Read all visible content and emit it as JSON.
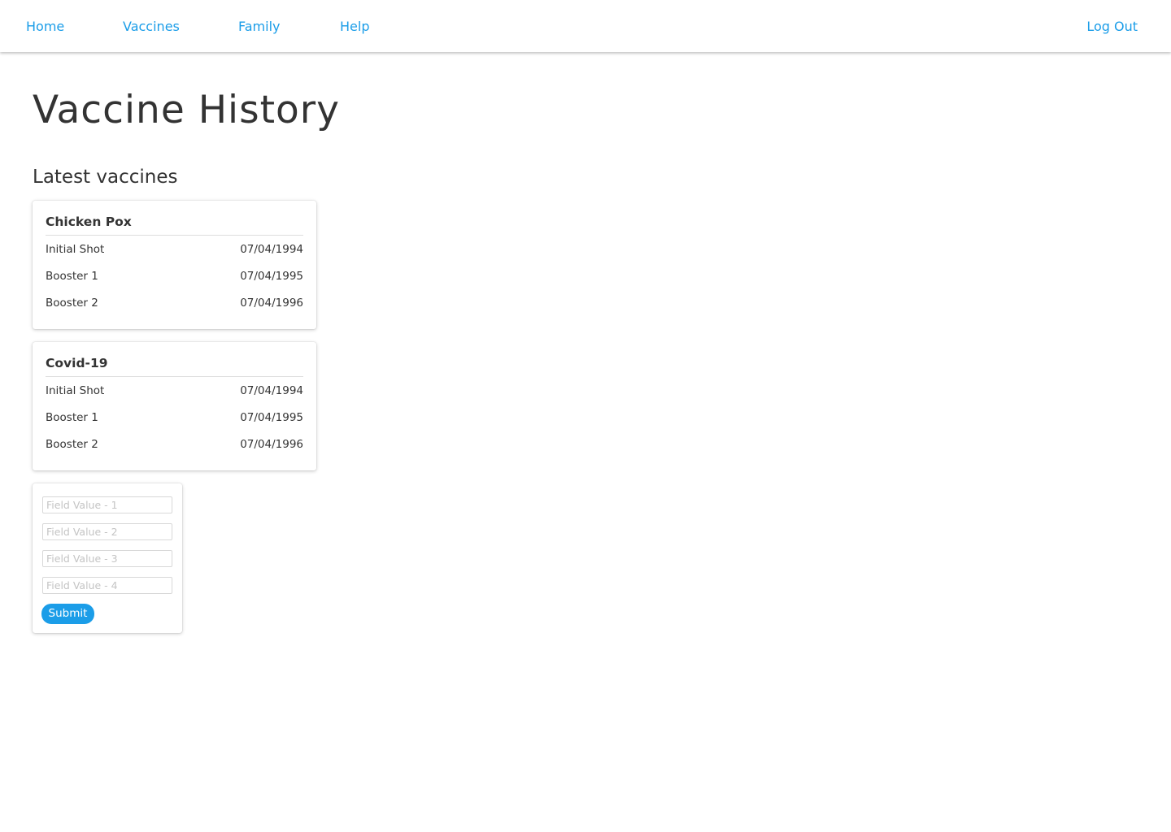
{
  "nav": {
    "items": [
      {
        "label": "Home"
      },
      {
        "label": "Vaccines"
      },
      {
        "label": "Family"
      },
      {
        "label": "Help"
      }
    ],
    "logout_label": "Log Out",
    "link_color": "#1b9de8"
  },
  "page": {
    "title": "Vaccine History",
    "section_title": "Latest vaccines"
  },
  "vaccines": [
    {
      "name": "Chicken Pox",
      "doses": [
        {
          "label": "Initial Shot",
          "date": "07/04/1994"
        },
        {
          "label": "Booster 1",
          "date": "07/04/1995"
        },
        {
          "label": "Booster 2",
          "date": "07/04/1996"
        }
      ]
    },
    {
      "name": "Covid-19",
      "doses": [
        {
          "label": "Initial Shot",
          "date": "07/04/1994"
        },
        {
          "label": "Booster 1",
          "date": "07/04/1995"
        },
        {
          "label": "Booster 2",
          "date": "07/04/1996"
        }
      ]
    }
  ],
  "form": {
    "fields": [
      {
        "value": "",
        "placeholder": "Field Value - 1"
      },
      {
        "value": "",
        "placeholder": "Field Value - 2"
      },
      {
        "value": "",
        "placeholder": "Field Value - 3"
      },
      {
        "value": "",
        "placeholder": "Field Value - 4"
      }
    ],
    "submit_label": "Submit",
    "accent_color": "#1b9de8"
  }
}
